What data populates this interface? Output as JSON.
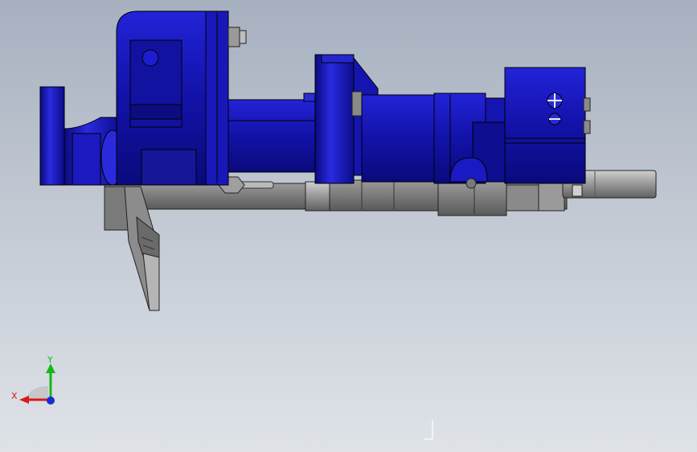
{
  "triad": {
    "x_label": "X",
    "y_label": "Y",
    "colors": {
      "x": "#d41a1a",
      "y": "#18b518",
      "z": "#1a2bd4"
    }
  },
  "model": {
    "colors": {
      "primary_blue": "#1414b4",
      "dark_blue": "#070770",
      "light_blue": "#3a3ae0",
      "steel_light": "#a9a9a9",
      "steel_mid": "#8a8a8a",
      "steel_dark": "#5e5e5e"
    }
  },
  "icons": {
    "triad": "coordinate-triad-icon",
    "cursor": "cursor-icon"
  }
}
